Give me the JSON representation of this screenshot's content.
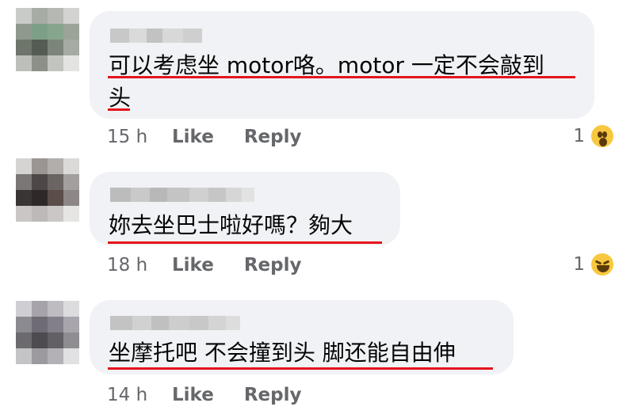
{
  "comments": [
    {
      "text_line1": "可以考虑坐 motor咯。motor 一定不会敲到",
      "text_line2": "头",
      "time": "15 h",
      "like": "Like",
      "reply": "Reply",
      "reaction_count": "1",
      "reaction_icon": "wow-emoji-icon"
    },
    {
      "text_line1": "妳去坐巴士啦好嗎？夠大",
      "time": "18 h",
      "like": "Like",
      "reply": "Reply",
      "reaction_count": "1",
      "reaction_icon": "haha-emoji-icon"
    },
    {
      "text_line1": "坐摩托吧 不会撞到头 脚还能自由伸",
      "time": "14 h",
      "like": "Like",
      "reply": "Reply"
    }
  ],
  "colors": {
    "bubble": "#f0f2f5",
    "underline": "#e4141b",
    "meta_text": "#65676b",
    "body_text": "#050505"
  }
}
